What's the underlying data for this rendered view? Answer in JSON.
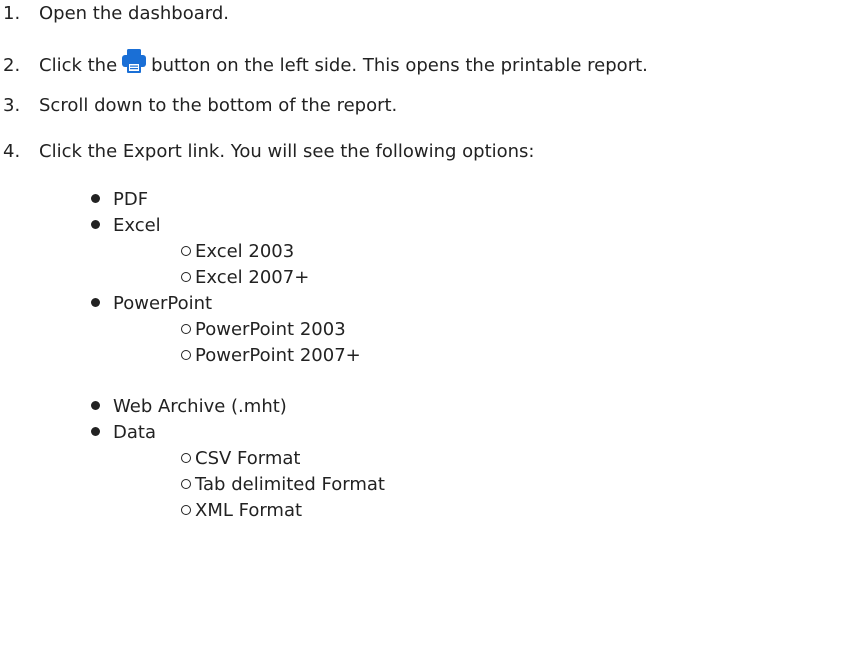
{
  "steps": [
    {
      "number": "1.",
      "text": "Open the dashboard."
    },
    {
      "number": "2.",
      "before": "Click the",
      "icon": "printer-icon",
      "after": "button on the left side. This opens the printable report."
    },
    {
      "number": "3.",
      "text": "Scroll down to the bottom of the report."
    },
    {
      "number": "4.",
      "text": "Click the Export link. You will see the following options:"
    }
  ],
  "options": [
    {
      "label": "PDF"
    },
    {
      "label": "Excel",
      "sub": [
        "Excel 2003",
        "Excel 2007+"
      ]
    },
    {
      "label": "PowerPoint",
      "sub": [
        "PowerPoint 2003",
        "PowerPoint 2007+"
      ]
    },
    {
      "label": "Web Archive (.mht)"
    },
    {
      "label": "Data",
      "sub": [
        "CSV Format",
        "Tab delimited Format",
        "XML Format"
      ]
    }
  ],
  "colors": {
    "text": "#222222",
    "printer_icon": "#1a6fd6"
  }
}
